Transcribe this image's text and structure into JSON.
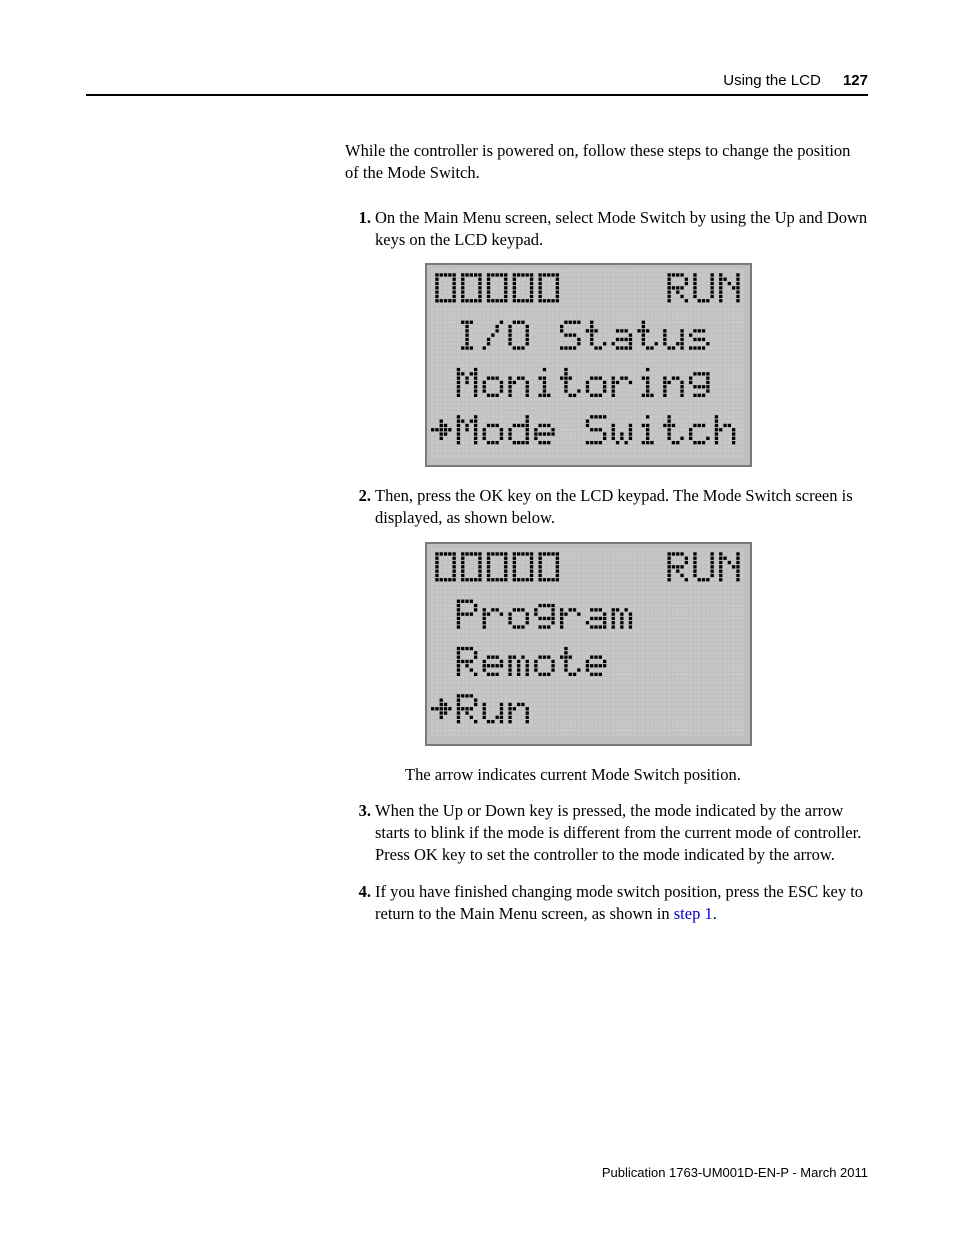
{
  "header": {
    "section_title": "Using the LCD",
    "page_number": "127"
  },
  "intro": "While the controller is powered on, follow these steps to change the position of the Mode Switch.",
  "steps": [
    {
      "num": "1.",
      "text": "On the Main Menu screen, select Mode Switch by using the Up and Down keys on the LCD keypad."
    },
    {
      "num": "2.",
      "text": "Then, press the OK key on the LCD keypad. The Mode Switch screen is displayed, as shown below."
    },
    {
      "num": "3.",
      "text": "When the Up or Down key is pressed, the mode indicated by the arrow starts to blink if the mode is different from the current mode of controller. Press OK key to set the controller to the mode indicated by the arrow."
    },
    {
      "num": "4.",
      "text_before_link": "If you have finished changing mode switch position, press the ESC key to return to the Main Menu screen, as shown in ",
      "link_text": "step 1",
      "text_after_link": "."
    }
  ],
  "between_text": "The arrow indicates current Mode Switch position.",
  "lcd1": {
    "header_left": "00000",
    "header_right": "RUN",
    "lines": [
      {
        "text": "I/O Status",
        "selected": false
      },
      {
        "text": "Monitoring",
        "selected": false
      },
      {
        "text": "Mode Switch",
        "selected": true
      }
    ]
  },
  "lcd2": {
    "header_left": "00000",
    "header_right": "RUN",
    "lines": [
      {
        "text": "Program",
        "selected": false
      },
      {
        "text": "Remote",
        "selected": false
      },
      {
        "text": "Run",
        "selected": true
      }
    ]
  },
  "chart_data": {
    "type": "table",
    "note": "LCD screen contents rendered as dot-matrix displays",
    "screens": [
      {
        "name": "Main Menu",
        "status_indicator": "00000",
        "mode": "RUN",
        "menu_items": [
          "I/O Status",
          "Monitoring",
          "Mode Switch"
        ],
        "cursor_on": "Mode Switch"
      },
      {
        "name": "Mode Switch",
        "status_indicator": "00000",
        "mode": "RUN",
        "menu_items": [
          "Program",
          "Remote",
          "Run"
        ],
        "cursor_on": "Run"
      }
    ]
  },
  "footer": "Publication 1763-UM001D-EN-P - March 2011"
}
